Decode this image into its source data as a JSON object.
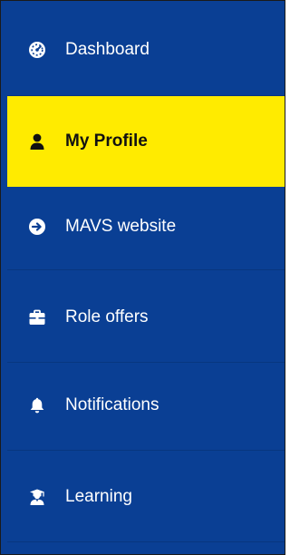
{
  "sidebar": {
    "items": [
      {
        "label": "Dashboard",
        "icon": "dashboard-gauge-icon",
        "active": false
      },
      {
        "label": "My Profile",
        "icon": "user-icon",
        "active": true
      },
      {
        "label": "MAVS website",
        "icon": "arrow-circle-right-icon",
        "active": false
      },
      {
        "label": "Role offers",
        "icon": "briefcase-icon",
        "active": false
      },
      {
        "label": "Notifications",
        "icon": "bell-icon",
        "active": false
      },
      {
        "label": "Learning",
        "icon": "graduate-icon",
        "active": false
      }
    ]
  },
  "colors": {
    "sidebar_bg": "#0a3f94",
    "active_bg": "#ffeb00",
    "text": "#ffffff",
    "active_text": "#111111"
  }
}
